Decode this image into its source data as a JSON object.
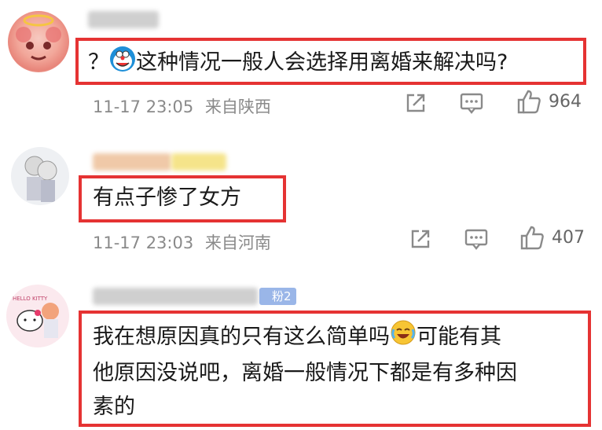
{
  "comments": [
    {
      "text_prefix": "？",
      "text": "这种情况一般人会选择用离婚来解决吗?",
      "time": "11-17 23:05",
      "location": "来自陕西",
      "likes": "964"
    },
    {
      "text": "有点子惨了女方",
      "time": "11-17 23:03",
      "location": "来自河南",
      "likes": "407"
    },
    {
      "badge": "粉2",
      "text_line1_a": "我在想原因真的只有这么简单吗",
      "text_line1_b": "可能有其",
      "text_line2": "他原因没说吧，离婚一般情况下都是有多种因",
      "text_line3": "素的"
    }
  ],
  "icons": {
    "share": "share-icon",
    "comment": "comment-icon",
    "like": "thumbs-up-icon",
    "emoji1": "doraemon-emoji-icon",
    "emoji2": "crying-laugh-emoji-icon"
  },
  "colors": {
    "highlight_border": "#e53333",
    "meta": "#8a8a8a"
  }
}
